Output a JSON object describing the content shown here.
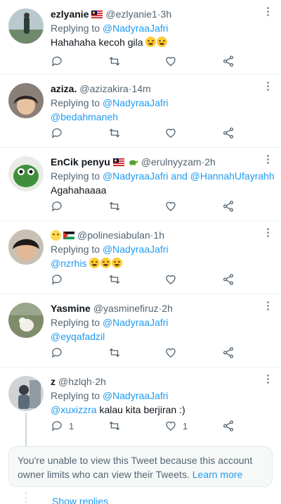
{
  "tweets": [
    {
      "name": "ezlyanie",
      "handle": "@ezlyanie1",
      "time": "3h",
      "replying_prefix": "Replying to ",
      "replying_to": "@NadyraaJafri",
      "replying_more": "",
      "text": "Hahahaha kecoh gila",
      "text_link": "",
      "reply_count": "",
      "like_count": ""
    },
    {
      "name": "aziza.",
      "handle": "@azizakira",
      "time": "14m",
      "replying_prefix": "Replying to ",
      "replying_to": "@NadyraaJafri",
      "replying_more": "",
      "text": "",
      "text_link": "@bedahmaneh",
      "reply_count": "",
      "like_count": ""
    },
    {
      "name": "EnCik penyu",
      "handle": "@erulnyyzam",
      "time": "2h",
      "replying_prefix": "Replying to ",
      "replying_to": "@NadyraaJafri",
      "replying_more": " and @HannahUfayrahh",
      "text": "Agahahaaaa",
      "text_link": "",
      "reply_count": "",
      "like_count": ""
    },
    {
      "name": "",
      "handle": "@polinesiabulan",
      "time": "1h",
      "replying_prefix": "Replying to ",
      "replying_to": "@NadyraaJafri",
      "replying_more": "",
      "text": "",
      "text_link": "@nzrhis",
      "reply_count": "",
      "like_count": ""
    },
    {
      "name": "Yasmine",
      "handle": "@yasminefiruz",
      "time": "2h",
      "replying_prefix": "Replying to ",
      "replying_to": "@NadyraaJafri",
      "replying_more": "",
      "text": "",
      "text_link": "@eyqafadzil",
      "reply_count": "",
      "like_count": ""
    },
    {
      "name": "z",
      "handle": "@hzlqh",
      "time": "2h",
      "replying_prefix": "Replying to ",
      "replying_to": "@NadyraaJafri",
      "replying_more": "",
      "text": " kalau kita berjiran :)",
      "text_link": "@xuxizzra",
      "reply_count": "1",
      "like_count": "1"
    }
  ],
  "separator": " · ",
  "notice": {
    "text": "You're unable to view this Tweet because this account owner limits who can view their Tweets. ",
    "link": "Learn more"
  },
  "show_replies": "Show replies",
  "colors": {
    "link": "#1d9bf0",
    "secondary": "#536471",
    "divider": "#eff3f4"
  }
}
